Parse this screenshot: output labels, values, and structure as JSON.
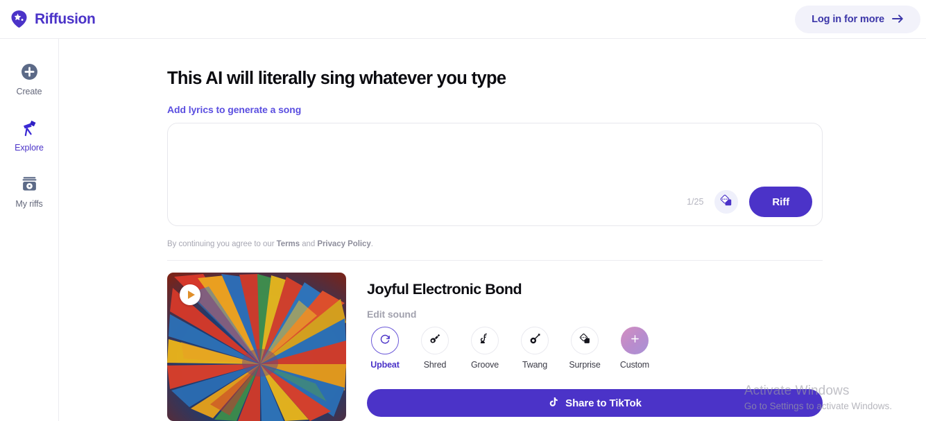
{
  "header": {
    "brand_name": "Riffusion",
    "brand_icon": "riffusion-logo-icon",
    "login_label": "Log in for more",
    "login_icon": "arrow-right-icon",
    "brand_color": "#4b33c8"
  },
  "sidebar": {
    "items": [
      {
        "label": "Create",
        "icon": "plus-circle-icon",
        "active": false
      },
      {
        "label": "Explore",
        "icon": "telescope-icon",
        "active": true
      },
      {
        "label": "My riffs",
        "icon": "vinyl-record-icon",
        "active": false
      }
    ]
  },
  "main": {
    "title": "This AI will literally sing whatever you type",
    "subtitle_link": "Add lyrics to generate a song",
    "compose": {
      "value": "",
      "placeholder": "",
      "char_count": "1/25",
      "shuffle_icon": "dice-icon",
      "submit_label": "Riff"
    },
    "terms": {
      "prefix": "By continuing you agree to our ",
      "terms_label": "Terms",
      "middle": " and ",
      "privacy_label": "Privacy Policy",
      "suffix": "."
    },
    "song": {
      "title": "Joyful Electronic Bond",
      "edit_label": "Edit sound",
      "play_icon": "play-icon",
      "artwork_alt": "colorful-radial-burst-artwork",
      "styles": [
        {
          "label": "Upbeat",
          "icon": "refresh-icon",
          "selected": true
        },
        {
          "label": "Shred",
          "icon": "guitar-icon",
          "selected": false
        },
        {
          "label": "Groove",
          "icon": "saxophone-icon",
          "selected": false
        },
        {
          "label": "Twang",
          "icon": "banjo-icon",
          "selected": false
        },
        {
          "label": "Surprise",
          "icon": "dice-icon",
          "selected": false
        },
        {
          "label": "Custom",
          "icon": "plus-icon",
          "selected": false
        }
      ],
      "share": {
        "label": "Share to TikTok",
        "icon": "tiktok-icon",
        "color": "#4b33c8"
      }
    }
  },
  "watermark": {
    "line1": "Activate Windows",
    "line2": "Go to Settings to activate Windows."
  }
}
